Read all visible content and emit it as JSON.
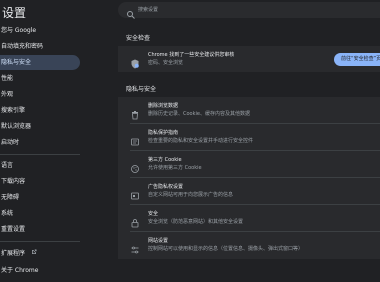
{
  "sidebar": {
    "title": "设置",
    "items": [
      {
        "label": "您与 Google",
        "active": false
      },
      {
        "label": "自动填充和密码",
        "active": false
      },
      {
        "label": "隐私与安全",
        "active": true
      },
      {
        "label": "性能",
        "active": false
      },
      {
        "label": "外观",
        "active": false
      },
      {
        "label": "搜索引擎",
        "active": false
      },
      {
        "label": "默认浏览器",
        "active": false
      },
      {
        "label": "启动时",
        "active": false
      },
      {
        "label": "语言",
        "active": false
      },
      {
        "label": "下载内容",
        "active": false
      },
      {
        "label": "无障碍",
        "active": false
      },
      {
        "label": "系统",
        "active": false
      },
      {
        "label": "重置设置",
        "active": false
      },
      {
        "label": "扩展程序",
        "active": false
      },
      {
        "label": "关于 Chrome",
        "active": false
      }
    ],
    "extensions_icon": "external-link-icon"
  },
  "search": {
    "placeholder": "搜索设置"
  },
  "safety_check": {
    "section_title": "安全检查",
    "title": "Chrome 找到了一些安全建议供您审核",
    "desc": "密码、安全浏览",
    "button_label": "前往“安全检查”页面"
  },
  "privacy": {
    "section_title": "隐私与安全",
    "rows": [
      {
        "title": "删除浏览数据",
        "desc": "删除历史记录、Cookie、缓存内容及其他数据",
        "icon": "trash-icon"
      },
      {
        "title": "隐私保护指南",
        "desc": "检查重要的隐私和安全设置并手动进行安全控件",
        "icon": "privacy-guide-icon"
      },
      {
        "title": "第三方 Cookie",
        "desc": "允许使用第三方 Cookie",
        "icon": "cookie-icon"
      },
      {
        "title": "广告隐私权设置",
        "desc": "自定义网站可用于向您展示广告的信息",
        "icon": "ad-privacy-icon"
      },
      {
        "title": "安全",
        "desc": "安全浏览（防范恶意网站）和其他安全设置",
        "icon": "lock-icon"
      },
      {
        "title": "网站设置",
        "desc": "控制网站可以使用和显示的信息（位置信息、摄像头、弹出式窗口等）",
        "icon": "site-settings-icon"
      }
    ]
  },
  "colors": {
    "background": "#202124",
    "card": "#292a2d",
    "accent": "#8ab4f8",
    "active_nav": "#394457"
  }
}
